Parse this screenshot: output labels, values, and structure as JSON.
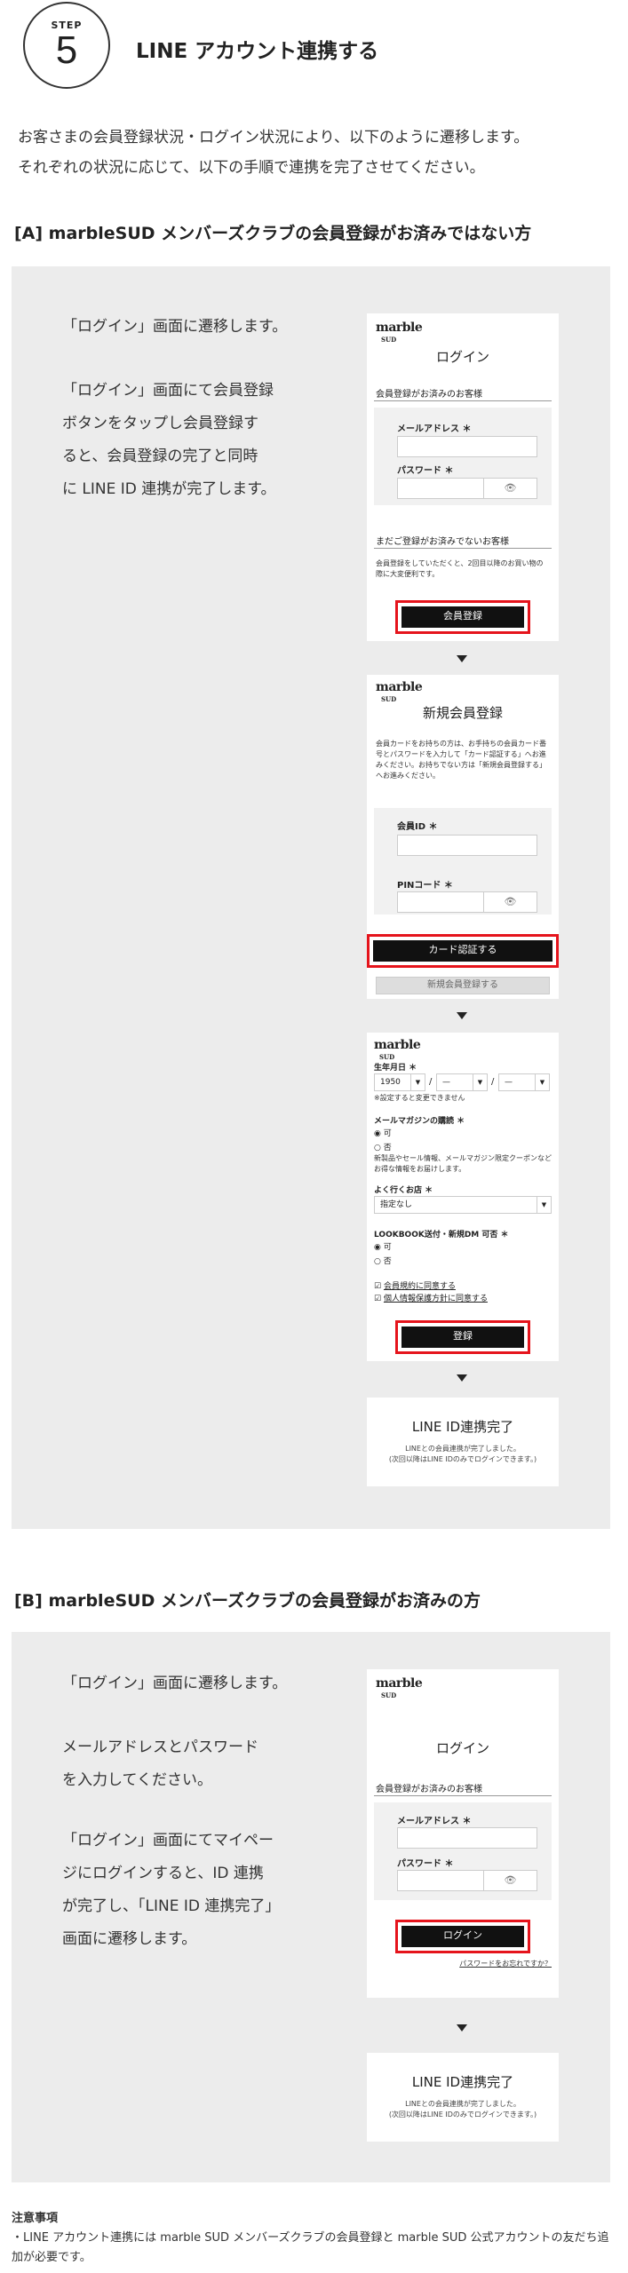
{
  "step": {
    "label": "STEP",
    "number": "5",
    "title": "LINE アカウント連携する"
  },
  "intro": [
    "お客さまの会員登録状況・ログイン状況により、以下のように遷移します。",
    "それぞれの状況に応じて、以下の手順で連携を完了させてください。"
  ],
  "sectionA": {
    "heading": "[A] marbleSUD メンバーズクラブの会員登録がお済みではない方",
    "desc1": "「ログイン」画面に遷移します。",
    "desc2": [
      "「ログイン」画面にて会員登録",
      "ボタンをタップし会員登録す",
      "ると、会員登録の完了と同時",
      "に LINE ID 連携が完了します。"
    ],
    "login": {
      "logo": "marble",
      "logo_sub": "SUD",
      "title": "ログイン",
      "member_heading": "会員登録がお済みのお客様",
      "email_label": "メールアドレス ＊",
      "password_label": "パスワード ＊",
      "eye": "👁",
      "nonmember_heading": "まだご登録がお済みでないお客様",
      "note": "会員登録をしていただくと、2回目以降のお買い物の際に大変便利です。",
      "register_btn": "会員登録"
    },
    "newreg": {
      "logo": "marble",
      "logo_sub": "SUD",
      "title": "新規会員登録",
      "note": "会員カードをお持ちの方は、お手持ちの会員カード番号とパスワードを入力して「カード認証する」へお進みください。お持ちでない方は「新規会員登録する」へお進みください。",
      "member_id_label": "会員ID ＊",
      "pin_label": "PINコード ＊",
      "eye": "👁",
      "card_btn": "カード認証する",
      "new_btn": "新規会員登録する"
    },
    "form": {
      "logo": "marble",
      "logo_sub": "SUD",
      "birth_label": "生年月日 ＊",
      "year": "1950",
      "month": "—",
      "day": "—",
      "slash": "/",
      "birth_note": "※設定すると変更できません",
      "mail_label": "メールマガジンの購読 ＊",
      "opt_yes": "可",
      "opt_no": "否",
      "mail_note": "新製品やセール情報、メールマガジン限定クーポンなどお得な情報をお届けします。",
      "shop_label": "よく行くお店 ＊",
      "shop_value": "指定なし",
      "dm_label": "LOOKBOOK送付・新規DM 可否 ＊",
      "dm_yes": "可",
      "dm_no": "否",
      "agree1": "会員規約に同意する",
      "agree2": "個人情報保護方針に同意する",
      "submit_btn": "登録"
    },
    "done": {
      "title": "LINE ID連携完了",
      "msg1": "LINEとの会員連携が完了しました。",
      "msg2": "(次回以降はLINE IDのみでログインできます。)"
    }
  },
  "sectionB": {
    "heading": "[B] marbleSUD メンバーズクラブの会員登録がお済みの方",
    "desc1": "「ログイン」画面に遷移します。",
    "desc2": [
      "メールアドレスとパスワード",
      "を入力してください。"
    ],
    "desc3": [
      "「ログイン」画面にてマイペー",
      "ジにログインすると、ID 連携",
      "が完了し、「LINE ID 連携完了」",
      "画面に遷移します。"
    ],
    "login": {
      "logo": "marble",
      "logo_sub": "SUD",
      "title": "ログイン",
      "member_heading": "会員登録がお済みのお客様",
      "email_label": "メールアドレス ＊",
      "password_label": "パスワード ＊",
      "eye": "👁",
      "login_btn": "ログイン",
      "forgot": "パスワードをお忘れですか？"
    },
    "done": {
      "title": "LINE ID連携完了",
      "msg1": "LINEとの会員連携が完了しました。",
      "msg2": "(次回以降はLINE IDのみでログインできます。)"
    }
  },
  "notes": {
    "heading": "注意事項",
    "lines": [
      "・LINE アカウント連携には marble SUD メンバーズクラブの会員登録と marble SUD 公式アカウントの友だち追",
      "加が必要です。"
    ]
  }
}
